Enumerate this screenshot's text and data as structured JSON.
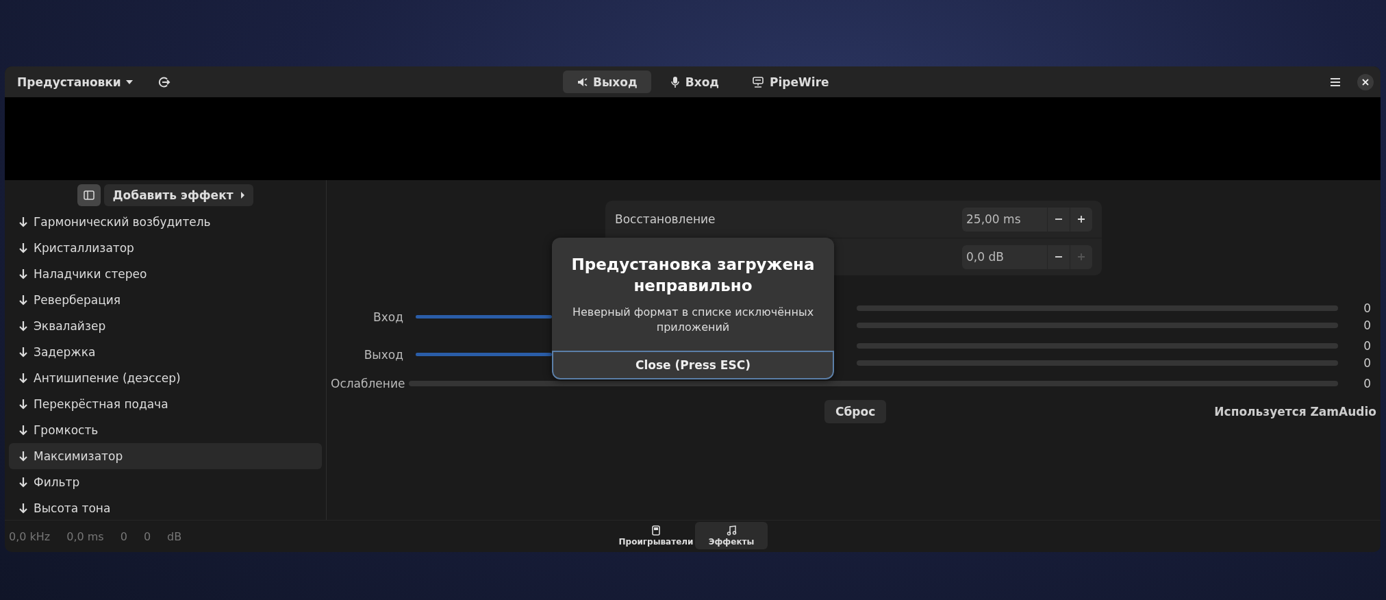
{
  "header": {
    "presets_label": "Предустановки",
    "tabs": [
      {
        "label": "Выход",
        "selected": true
      },
      {
        "label": "Вход",
        "selected": false
      },
      {
        "label": "PipeWire",
        "selected": false
      }
    ]
  },
  "sidebar": {
    "toggle_selected": true,
    "add_effect_label": "Добавить эффект",
    "effects": [
      {
        "label": "Гармонический возбудитель",
        "selected": false
      },
      {
        "label": "Кристаллизатор",
        "selected": false
      },
      {
        "label": "Наладчики стерео",
        "selected": false
      },
      {
        "label": "Реверберация",
        "selected": false
      },
      {
        "label": "Эквалайзер",
        "selected": false
      },
      {
        "label": "Задержка",
        "selected": false
      },
      {
        "label": "Антишипение (деэссер)",
        "selected": false
      },
      {
        "label": "Перекрёстная подача",
        "selected": false
      },
      {
        "label": "Громкость",
        "selected": false
      },
      {
        "label": "Максимизатор",
        "selected": true
      },
      {
        "label": "Фильтр",
        "selected": false
      },
      {
        "label": "Высота тона",
        "selected": false
      }
    ]
  },
  "settings": [
    {
      "label": "Восстановление",
      "value": "25,00 ms",
      "plus_disabled": false
    },
    {
      "value": "0,0 dB",
      "plus_disabled": true
    }
  ],
  "meters": [
    {
      "kind": "gain",
      "label": "Вход",
      "level": 1,
      "bars": [
        {
          "level": 0,
          "reading": "0"
        },
        {
          "level": 0,
          "reading": "0"
        }
      ]
    },
    {
      "kind": "gain",
      "label": "Выход",
      "level": 1,
      "bars": [
        {
          "level": 0,
          "reading": "0"
        },
        {
          "level": 0,
          "reading": "0"
        }
      ]
    },
    {
      "kind": "plain",
      "label": "Ослабление",
      "bars": [
        {
          "level": 0,
          "reading": "0"
        }
      ]
    }
  ],
  "reset_button": "Сброс",
  "plugin_credit": "Используется ZamAudio",
  "dialog": {
    "title": "Предустановка загружена неправильно",
    "message": "Неверный формат в списке исключённых приложений",
    "button": "Close (Press ESC)"
  },
  "status": [
    "0,0 kHz",
    "0,0 ms",
    "0",
    "0",
    "dB"
  ],
  "bottom_nav": [
    {
      "label": "Проигрыватели",
      "selected": false
    },
    {
      "label": "Эффекты",
      "selected": true
    }
  ]
}
